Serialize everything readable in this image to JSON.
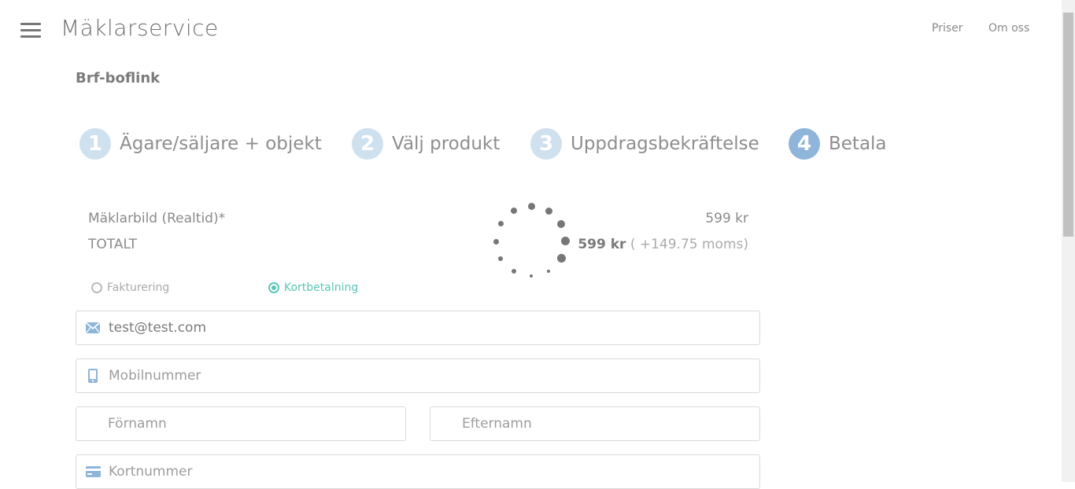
{
  "header": {
    "brand": "Mäklarservice",
    "nav": [
      {
        "label": "Priser"
      },
      {
        "label": "Om oss"
      }
    ]
  },
  "org_title": "Brf-boflink",
  "steps": [
    {
      "number": "1",
      "label": "Ägare/säljare + objekt"
    },
    {
      "number": "2",
      "label": "Välj produkt"
    },
    {
      "number": "3",
      "label": "Uppdragsbekräftelse"
    },
    {
      "number": "4",
      "label": "Betala",
      "active": true
    }
  ],
  "summary": {
    "item_label": "Mäklarbild (Realtid)*",
    "item_price": "599 kr",
    "total_label": "TOTALT",
    "total_price": "599 kr",
    "total_vat": "( +149.75 moms)"
  },
  "payment": {
    "options": [
      {
        "label": "Fakturering",
        "checked": false
      },
      {
        "label": "Kortbetalning",
        "checked": true
      }
    ]
  },
  "form": {
    "email": {
      "value": "test@test.com",
      "icon": "envelope-icon"
    },
    "mobile": {
      "placeholder": "Mobilnummer",
      "icon": "phone-icon"
    },
    "first_name": {
      "placeholder": "Förnamn"
    },
    "last_name": {
      "placeholder": "Efternamn"
    },
    "card": {
      "placeholder": "Kortnummer",
      "icon": "credit-card-icon"
    }
  },
  "colors": {
    "accent": "#5cc6b6",
    "step_inactive": "#cfe0ee",
    "step_active": "#8fb5db",
    "icon": "#8fb5db"
  }
}
